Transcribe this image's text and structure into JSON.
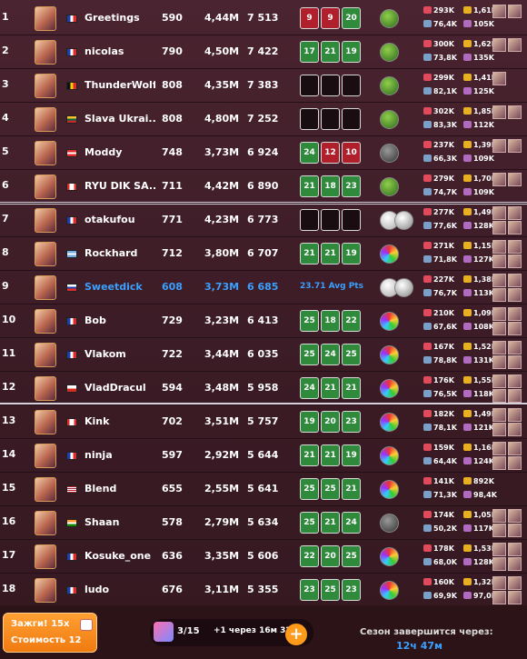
{
  "leaderboard": [
    {
      "rank": "1",
      "name": "Greetings",
      "flag": "France",
      "c1": "590",
      "c2": "4,44M",
      "c3": "7 513",
      "slots": [
        [
          "9",
          "red"
        ],
        [
          "9",
          "red"
        ],
        [
          "20",
          "green"
        ]
      ],
      "orb": "green",
      "orb2": false,
      "stats": [
        "293K",
        "1,61M",
        "76,4K",
        "105K"
      ],
      "cards": 2
    },
    {
      "rank": "2",
      "name": "nicolas",
      "flag": "France",
      "c1": "790",
      "c2": "4,50M",
      "c3": "7 422",
      "slots": [
        [
          "17",
          "green"
        ],
        [
          "21",
          "green"
        ],
        [
          "19",
          "green"
        ]
      ],
      "orb": "green",
      "orb2": false,
      "stats": [
        "300K",
        "1,62M",
        "73,8K",
        "135K"
      ],
      "cards": 2
    },
    {
      "rank": "3",
      "name": "ThunderWolf",
      "flag": "Belgium",
      "c1": "808",
      "c2": "4,35M",
      "c3": "7 383",
      "slots": [
        [
          "",
          "empty"
        ],
        [
          "",
          "empty"
        ],
        [
          "",
          "empty"
        ]
      ],
      "orb": "green",
      "orb2": false,
      "stats": [
        "299K",
        "1,41M",
        "82,1K",
        "125K"
      ],
      "cards": 1
    },
    {
      "rank": "4",
      "name": "Slava Ukrai...",
      "flag": "Lithuania",
      "c1": "808",
      "c2": "4,80M",
      "c3": "7 252",
      "slots": [
        [
          "",
          "empty"
        ],
        [
          "",
          "empty"
        ],
        [
          "",
          "empty"
        ]
      ],
      "orb": "green",
      "orb2": false,
      "stats": [
        "302K",
        "1,85M",
        "83,3K",
        "112K"
      ],
      "cards": 2
    },
    {
      "rank": "5",
      "name": "Moddy",
      "flag": "Austria",
      "c1": "748",
      "c2": "3,73M",
      "c3": "6 924",
      "slots": [
        [
          "24",
          "green"
        ],
        [
          "12",
          "red"
        ],
        [
          "10",
          "red"
        ]
      ],
      "orb": "dark",
      "orb2": false,
      "stats": [
        "237K",
        "1,39M",
        "66,3K",
        "109K"
      ],
      "cards": 2
    },
    {
      "rank": "6",
      "name": "RYU DIK SA...",
      "flag": "Canada",
      "c1": "711",
      "c2": "4,42M",
      "c3": "6 890",
      "slots": [
        [
          "21",
          "green"
        ],
        [
          "18",
          "green"
        ],
        [
          "23",
          "green"
        ]
      ],
      "orb": "green",
      "orb2": false,
      "stats": [
        "279K",
        "1,70M",
        "74,7K",
        "109K"
      ],
      "cards": 2
    },
    {
      "rank": "7",
      "name": "otakufou",
      "flag": "France",
      "c1": "771",
      "c2": "4,23M",
      "c3": "6 773",
      "slots": [
        [
          "",
          "empty"
        ],
        [
          "",
          "empty"
        ],
        [
          "",
          "empty"
        ]
      ],
      "orb": "white",
      "orb2": true,
      "stats": [
        "277K",
        "1,49M",
        "77,6K",
        "128K"
      ],
      "cards": 4
    },
    {
      "rank": "8",
      "name": "Rockhard",
      "flag": "Argentina",
      "c1": "712",
      "c2": "3,80M",
      "c3": "6 707",
      "slots": [
        [
          "21",
          "green"
        ],
        [
          "21",
          "green"
        ],
        [
          "19",
          "green"
        ]
      ],
      "orb": "rainbow",
      "orb2": false,
      "stats": [
        "271K",
        "1,15M",
        "71,8K",
        "127K"
      ],
      "cards": 4
    },
    {
      "rank": "9",
      "name": "Sweetdick",
      "flag": "Russia",
      "c1": "608",
      "c2": "3,73M",
      "c3": "6 685",
      "avg": "23.71 Avg Pts",
      "slots": [],
      "orb": "white",
      "orb2": true,
      "stats": [
        "227K",
        "1,38M",
        "76,7K",
        "113K"
      ],
      "cards": 4,
      "self": true
    },
    {
      "rank": "10",
      "name": "Bob",
      "flag": "France",
      "c1": "729",
      "c2": "3,23M",
      "c3": "6 413",
      "slots": [
        [
          "25",
          "green"
        ],
        [
          "18",
          "green"
        ],
        [
          "22",
          "green"
        ]
      ],
      "orb": "rainbow",
      "orb2": false,
      "stats": [
        "210K",
        "1,09M",
        "67,6K",
        "108K"
      ],
      "cards": 4
    },
    {
      "rank": "11",
      "name": "Vlakom",
      "flag": "France",
      "c1": "722",
      "c2": "3,44M",
      "c3": "6 035",
      "slots": [
        [
          "25",
          "green"
        ],
        [
          "24",
          "green"
        ],
        [
          "25",
          "green"
        ]
      ],
      "orb": "rainbow",
      "orb2": false,
      "stats": [
        "167K",
        "1,52M",
        "78,8K",
        "131K"
      ],
      "cards": 4
    },
    {
      "rank": "12",
      "name": "VladDracul",
      "flag": "Chile",
      "c1": "594",
      "c2": "3,48M",
      "c3": "5 958",
      "slots": [
        [
          "24",
          "green"
        ],
        [
          "21",
          "green"
        ],
        [
          "21",
          "green"
        ]
      ],
      "orb": "rainbow",
      "orb2": false,
      "stats": [
        "176K",
        "1,55M",
        "76,5K",
        "118K"
      ],
      "cards": 4
    },
    {
      "rank": "13",
      "name": "Kink",
      "flag": "Canada",
      "c1": "702",
      "c2": "3,51M",
      "c3": "5 757",
      "slots": [
        [
          "19",
          "green"
        ],
        [
          "20",
          "green"
        ],
        [
          "23",
          "green"
        ]
      ],
      "orb": "rainbow",
      "orb2": false,
      "stats": [
        "182K",
        "1,49M",
        "78,1K",
        "121K"
      ],
      "cards": 4
    },
    {
      "rank": "14",
      "name": "ninja",
      "flag": "France",
      "c1": "597",
      "c2": "2,92M",
      "c3": "5 644",
      "slots": [
        [
          "21",
          "green"
        ],
        [
          "21",
          "green"
        ],
        [
          "19",
          "green"
        ]
      ],
      "orb": "rainbow",
      "orb2": false,
      "stats": [
        "159K",
        "1,16M",
        "64,4K",
        "124K"
      ],
      "cards": 4
    },
    {
      "rank": "15",
      "name": "Blend",
      "flag": "USA",
      "c1": "655",
      "c2": "2,55M",
      "c3": "5 641",
      "slots": [
        [
          "25",
          "green"
        ],
        [
          "25",
          "green"
        ],
        [
          "21",
          "green"
        ]
      ],
      "orb": "rainbow",
      "orb2": false,
      "stats": [
        "141K",
        "892K",
        "71,3K",
        "98,4K"
      ],
      "cards": 0
    },
    {
      "rank": "16",
      "name": "Shaan",
      "flag": "India",
      "c1": "578",
      "c2": "2,79M",
      "c3": "5 634",
      "slots": [
        [
          "25",
          "green"
        ],
        [
          "21",
          "green"
        ],
        [
          "24",
          "green"
        ]
      ],
      "orb": "dark",
      "orb2": false,
      "stats": [
        "174K",
        "1,05M",
        "50,2K",
        "117K"
      ],
      "cards": 4
    },
    {
      "rank": "17",
      "name": "Kosuke_one",
      "flag": "France",
      "c1": "636",
      "c2": "3,35M",
      "c3": "5 606",
      "slots": [
        [
          "22",
          "green"
        ],
        [
          "20",
          "green"
        ],
        [
          "25",
          "green"
        ]
      ],
      "orb": "rainbow",
      "orb2": false,
      "stats": [
        "178K",
        "1,53M",
        "68,0K",
        "128K"
      ],
      "cards": 4
    },
    {
      "rank": "18",
      "name": "ludo",
      "flag": "France",
      "c1": "676",
      "c2": "3,11M",
      "c3": "5 355",
      "slots": [
        [
          "23",
          "green"
        ],
        [
          "25",
          "green"
        ],
        [
          "23",
          "green"
        ]
      ],
      "orb": "rainbow",
      "orb2": false,
      "stats": [
        "160K",
        "1,32M",
        "69,9K",
        "97,0K"
      ],
      "cards": 4
    }
  ],
  "bottom": {
    "kiss_label": "Зажги! 15x",
    "cost_label": "Стоимость 12",
    "energy_count": "3/15",
    "energy_timer": "+1 через 16м 32с",
    "plus": "+",
    "season_label": "Сезон завершится через:",
    "season_time": "12ч 47м"
  },
  "colors": {
    "green": "#2f8a3c",
    "red": "#b0202c",
    "self": "#3aa0ff",
    "accent": "#ff9a1a"
  }
}
